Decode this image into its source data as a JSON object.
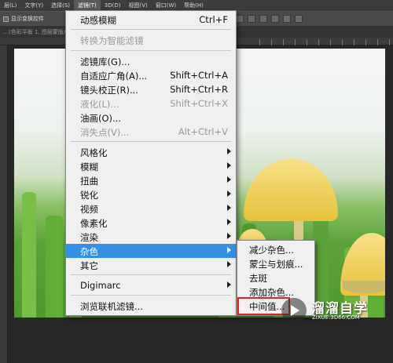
{
  "menubar": {
    "items": [
      {
        "label": "层(L)"
      },
      {
        "label": "文字(Y)"
      },
      {
        "label": "选择(S)"
      },
      {
        "label": "滤镜(T)",
        "active": true
      },
      {
        "label": "3D(D)"
      },
      {
        "label": "视图(V)"
      },
      {
        "label": "窗口(W)"
      },
      {
        "label": "帮助(H)"
      }
    ]
  },
  "optionsbar": {
    "show_transform_label": "显示变换控件"
  },
  "tabbar": {
    "doc_title": "…(色彩平衡 1, 图层蒙版/8)"
  },
  "filter_menu": {
    "items": [
      {
        "label": "动感模糊",
        "shortcut": "Ctrl+F"
      },
      {
        "label": "转换为智能滤镜",
        "disabled": true
      },
      {
        "label": "滤镜库(G)..."
      },
      {
        "label": "自适应广角(A)...",
        "shortcut": "Shift+Ctrl+A"
      },
      {
        "label": "镜头校正(R)...",
        "shortcut": "Shift+Ctrl+R"
      },
      {
        "label": "液化(L)...",
        "shortcut": "Shift+Ctrl+X",
        "disabled": true
      },
      {
        "label": "油画(O)..."
      },
      {
        "label": "消失点(V)...",
        "shortcut": "Alt+Ctrl+V",
        "disabled": true
      },
      {
        "label": "风格化"
      },
      {
        "label": "模糊"
      },
      {
        "label": "扭曲"
      },
      {
        "label": "锐化"
      },
      {
        "label": "视频"
      },
      {
        "label": "像素化"
      },
      {
        "label": "渲染"
      },
      {
        "label": "杂色",
        "highlighted": true
      },
      {
        "label": "其它"
      },
      {
        "label": "Digimarc"
      },
      {
        "label": "浏览联机滤镜..."
      }
    ]
  },
  "noise_submenu": {
    "items": [
      {
        "label": "减少杂色..."
      },
      {
        "label": "蒙尘与划痕..."
      },
      {
        "label": "去斑"
      },
      {
        "label": "添加杂色..."
      },
      {
        "label": "中间值...",
        "emphasized": true
      }
    ]
  },
  "watermark": {
    "brand": "溜溜自学",
    "url": "ZIXUE.3D66.COM"
  },
  "colors": {
    "highlight": "#3390e6",
    "annotation_box": "#e0261b",
    "menu_bg": "#f0f0f0"
  }
}
